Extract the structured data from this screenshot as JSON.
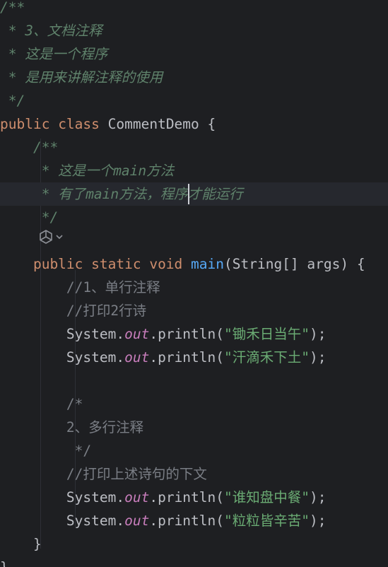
{
  "editor": {
    "lines": [
      {
        "tokens": [
          {
            "t": "/**",
            "c": "doc"
          }
        ]
      },
      {
        "tokens": [
          {
            "t": " * 3、文档注释",
            "c": "doc"
          }
        ]
      },
      {
        "tokens": [
          {
            "t": " * 这是一个程序",
            "c": "doc"
          }
        ]
      },
      {
        "tokens": [
          {
            "t": " * 是用来讲解注释的使用",
            "c": "doc"
          }
        ]
      },
      {
        "tokens": [
          {
            "t": " */",
            "c": "doc"
          }
        ]
      },
      {
        "tokens": [
          {
            "t": "public ",
            "c": "kw"
          },
          {
            "t": "class ",
            "c": "kw"
          },
          {
            "t": "CommentDemo {",
            "c": "plain"
          }
        ]
      },
      {
        "tokens": [
          {
            "t": "    /**",
            "c": "doc"
          }
        ]
      },
      {
        "tokens": [
          {
            "t": "     * 这是一个",
            "c": "doc"
          },
          {
            "t": "main",
            "c": "doc-code"
          },
          {
            "t": "方法",
            "c": "doc"
          }
        ]
      },
      {
        "tokens": [
          {
            "t": "     * 有了",
            "c": "doc"
          },
          {
            "t": "main",
            "c": "doc-code"
          },
          {
            "t": "方法，程序",
            "c": "doc"
          },
          {
            "t": "|caret|",
            "c": "caret"
          },
          {
            "t": "才能运行",
            "c": "doc"
          }
        ],
        "current": true
      },
      {
        "tokens": [
          {
            "t": "     */",
            "c": "doc"
          }
        ]
      },
      {
        "tokens": [],
        "gutter": true
      },
      {
        "tokens": [
          {
            "t": "    public ",
            "c": "kw"
          },
          {
            "t": "static ",
            "c": "kw"
          },
          {
            "t": "void ",
            "c": "kw"
          },
          {
            "t": "main",
            "c": "fn"
          },
          {
            "t": "(String[] args) {",
            "c": "plain"
          }
        ]
      },
      {
        "tokens": [
          {
            "t": "        //1、单行注释",
            "c": "cmt"
          }
        ]
      },
      {
        "tokens": [
          {
            "t": "        //打印2行诗",
            "c": "cmt"
          }
        ]
      },
      {
        "tokens": [
          {
            "t": "        System.",
            "c": "plain"
          },
          {
            "t": "out",
            "c": "field"
          },
          {
            "t": ".println(",
            "c": "plain"
          },
          {
            "t": "\"锄禾日当午\"",
            "c": "str"
          },
          {
            "t": ");",
            "c": "plain"
          }
        ]
      },
      {
        "tokens": [
          {
            "t": "        System.",
            "c": "plain"
          },
          {
            "t": "out",
            "c": "field"
          },
          {
            "t": ".println(",
            "c": "plain"
          },
          {
            "t": "\"汗滴禾下土\"",
            "c": "str"
          },
          {
            "t": ");",
            "c": "plain"
          }
        ]
      },
      {
        "tokens": []
      },
      {
        "tokens": [
          {
            "t": "        /*",
            "c": "cmt"
          }
        ]
      },
      {
        "tokens": [
          {
            "t": "        2、多行注释",
            "c": "cmt"
          }
        ]
      },
      {
        "tokens": [
          {
            "t": "         */",
            "c": "cmt"
          }
        ]
      },
      {
        "tokens": [
          {
            "t": "        //打印上述诗句的下文",
            "c": "cmt"
          }
        ]
      },
      {
        "tokens": [
          {
            "t": "        System.",
            "c": "plain"
          },
          {
            "t": "out",
            "c": "field"
          },
          {
            "t": ".println(",
            "c": "plain"
          },
          {
            "t": "\"谁知盘中餐\"",
            "c": "str"
          },
          {
            "t": ");",
            "c": "plain"
          }
        ]
      },
      {
        "tokens": [
          {
            "t": "        System.",
            "c": "plain"
          },
          {
            "t": "out",
            "c": "field"
          },
          {
            "t": ".println(",
            "c": "plain"
          },
          {
            "t": "\"粒粒皆辛苦\"",
            "c": "str"
          },
          {
            "t": ");",
            "c": "plain"
          }
        ]
      },
      {
        "tokens": [
          {
            "t": "    }",
            "c": "plain"
          }
        ]
      },
      {
        "tokens": [
          {
            "t": "}",
            "c": "plain"
          }
        ]
      }
    ],
    "gutter_icon": "ai-generate-icon",
    "gutter_chevron": "chevron-down-icon"
  },
  "colors": {
    "background": "#1e1f22",
    "current_line": "#26282e",
    "keyword": "#cf8e6d",
    "doc_comment": "#5f826b",
    "comment": "#7a7e85",
    "string": "#6aab73",
    "function": "#56a8f5",
    "field": "#c77dbb",
    "text": "#bcbec4"
  }
}
